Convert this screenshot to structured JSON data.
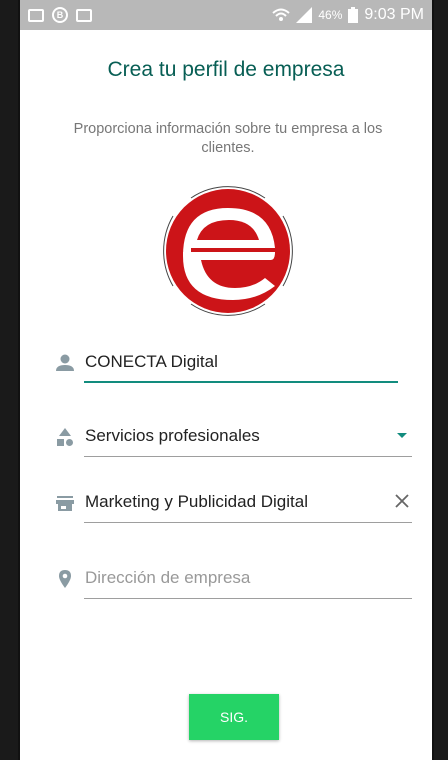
{
  "status_bar": {
    "battery_percent": "46%",
    "time": "9:03 PM",
    "icons": [
      "mail-icon",
      "bbm-icon",
      "image-icon",
      "wifi-icon",
      "signal-icon",
      "battery-icon"
    ]
  },
  "screen": {
    "title": "Crea tu perfil de empresa",
    "subtitle": "Proporciona información sobre tu empresa a los clientes."
  },
  "logo": {
    "letter": "e",
    "brand_color": "#cc1418"
  },
  "fields": {
    "name": {
      "value": "CONECTA Digital",
      "icon": "person-icon"
    },
    "category": {
      "value": "Servicios profesionales",
      "icon": "category-shapes-icon",
      "action_icon": "dropdown-arrow-icon"
    },
    "subcategory": {
      "value": "Marketing y Publicidad Digital",
      "icon": "store-icon",
      "action_icon": "clear-icon"
    },
    "address": {
      "placeholder": "Dirección de empresa",
      "icon": "location-pin-icon"
    }
  },
  "actions": {
    "next_label": "SIG."
  },
  "colors": {
    "accent": "#128c7e",
    "title": "#075e54",
    "button": "#25d366",
    "icon": "#8a9ba3"
  }
}
